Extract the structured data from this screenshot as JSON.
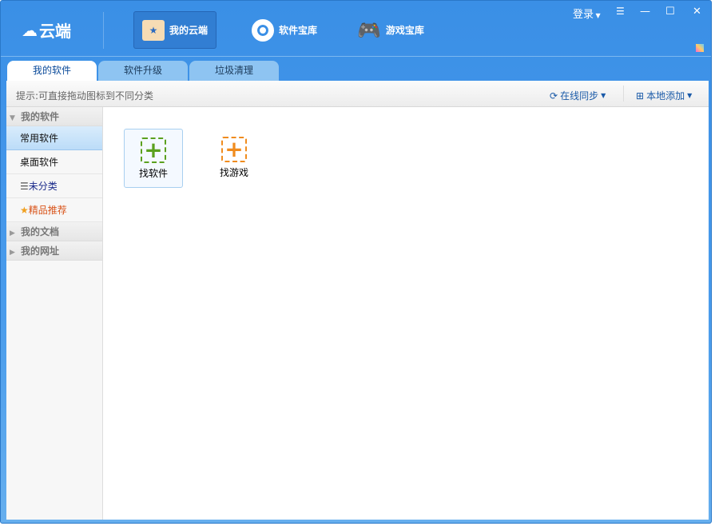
{
  "app": {
    "logo": "云端"
  },
  "nav": [
    {
      "label": "我的云端"
    },
    {
      "label": "软件宝库"
    },
    {
      "label": "游戏宝库"
    }
  ],
  "window": {
    "login": "登录"
  },
  "tabs": [
    {
      "label": "我的软件"
    },
    {
      "label": "软件升级"
    },
    {
      "label": "垃圾清理"
    }
  ],
  "toolbar": {
    "hint": "提示:可直接拖动图标到不同分类",
    "sync": "在线同步",
    "add_local": "本地添加"
  },
  "sidebar": {
    "group_software": "我的软件",
    "items": [
      {
        "label": "常用软件"
      },
      {
        "label": "桌面软件"
      },
      {
        "label": "未分类"
      },
      {
        "label": "精品推荐"
      }
    ],
    "group_docs": "我的文档",
    "group_urls": "我的网址"
  },
  "tiles": [
    {
      "label": "找软件"
    },
    {
      "label": "找游戏"
    }
  ],
  "colors": {
    "accent": "#3a8fe6",
    "green": "#5aa01e",
    "orange": "#f08c1e",
    "recommend": "#d9541a",
    "uncategorized": "#1a2a8a"
  }
}
